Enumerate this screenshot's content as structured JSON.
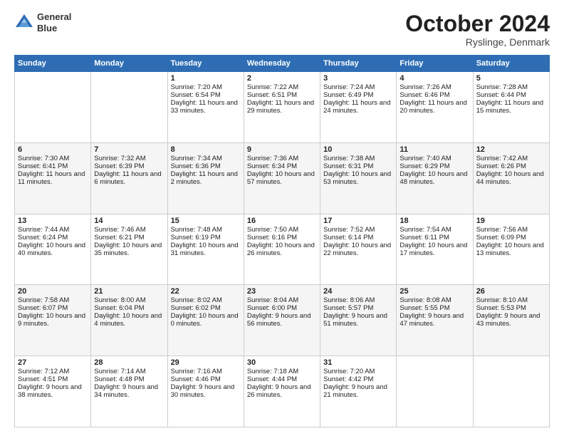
{
  "header": {
    "logo_line1": "General",
    "logo_line2": "Blue",
    "month_title": "October 2024",
    "location": "Ryslinge, Denmark"
  },
  "days_of_week": [
    "Sunday",
    "Monday",
    "Tuesday",
    "Wednesday",
    "Thursday",
    "Friday",
    "Saturday"
  ],
  "weeks": [
    [
      {
        "day": "",
        "sunrise": "",
        "sunset": "",
        "daylight": ""
      },
      {
        "day": "",
        "sunrise": "",
        "sunset": "",
        "daylight": ""
      },
      {
        "day": "1",
        "sunrise": "Sunrise: 7:20 AM",
        "sunset": "Sunset: 6:54 PM",
        "daylight": "Daylight: 11 hours and 33 minutes."
      },
      {
        "day": "2",
        "sunrise": "Sunrise: 7:22 AM",
        "sunset": "Sunset: 6:51 PM",
        "daylight": "Daylight: 11 hours and 29 minutes."
      },
      {
        "day": "3",
        "sunrise": "Sunrise: 7:24 AM",
        "sunset": "Sunset: 6:49 PM",
        "daylight": "Daylight: 11 hours and 24 minutes."
      },
      {
        "day": "4",
        "sunrise": "Sunrise: 7:26 AM",
        "sunset": "Sunset: 6:46 PM",
        "daylight": "Daylight: 11 hours and 20 minutes."
      },
      {
        "day": "5",
        "sunrise": "Sunrise: 7:28 AM",
        "sunset": "Sunset: 6:44 PM",
        "daylight": "Daylight: 11 hours and 15 minutes."
      }
    ],
    [
      {
        "day": "6",
        "sunrise": "Sunrise: 7:30 AM",
        "sunset": "Sunset: 6:41 PM",
        "daylight": "Daylight: 11 hours and 11 minutes."
      },
      {
        "day": "7",
        "sunrise": "Sunrise: 7:32 AM",
        "sunset": "Sunset: 6:39 PM",
        "daylight": "Daylight: 11 hours and 6 minutes."
      },
      {
        "day": "8",
        "sunrise": "Sunrise: 7:34 AM",
        "sunset": "Sunset: 6:36 PM",
        "daylight": "Daylight: 11 hours and 2 minutes."
      },
      {
        "day": "9",
        "sunrise": "Sunrise: 7:36 AM",
        "sunset": "Sunset: 6:34 PM",
        "daylight": "Daylight: 10 hours and 57 minutes."
      },
      {
        "day": "10",
        "sunrise": "Sunrise: 7:38 AM",
        "sunset": "Sunset: 6:31 PM",
        "daylight": "Daylight: 10 hours and 53 minutes."
      },
      {
        "day": "11",
        "sunrise": "Sunrise: 7:40 AM",
        "sunset": "Sunset: 6:29 PM",
        "daylight": "Daylight: 10 hours and 48 minutes."
      },
      {
        "day": "12",
        "sunrise": "Sunrise: 7:42 AM",
        "sunset": "Sunset: 6:26 PM",
        "daylight": "Daylight: 10 hours and 44 minutes."
      }
    ],
    [
      {
        "day": "13",
        "sunrise": "Sunrise: 7:44 AM",
        "sunset": "Sunset: 6:24 PM",
        "daylight": "Daylight: 10 hours and 40 minutes."
      },
      {
        "day": "14",
        "sunrise": "Sunrise: 7:46 AM",
        "sunset": "Sunset: 6:21 PM",
        "daylight": "Daylight: 10 hours and 35 minutes."
      },
      {
        "day": "15",
        "sunrise": "Sunrise: 7:48 AM",
        "sunset": "Sunset: 6:19 PM",
        "daylight": "Daylight: 10 hours and 31 minutes."
      },
      {
        "day": "16",
        "sunrise": "Sunrise: 7:50 AM",
        "sunset": "Sunset: 6:16 PM",
        "daylight": "Daylight: 10 hours and 26 minutes."
      },
      {
        "day": "17",
        "sunrise": "Sunrise: 7:52 AM",
        "sunset": "Sunset: 6:14 PM",
        "daylight": "Daylight: 10 hours and 22 minutes."
      },
      {
        "day": "18",
        "sunrise": "Sunrise: 7:54 AM",
        "sunset": "Sunset: 6:11 PM",
        "daylight": "Daylight: 10 hours and 17 minutes."
      },
      {
        "day": "19",
        "sunrise": "Sunrise: 7:56 AM",
        "sunset": "Sunset: 6:09 PM",
        "daylight": "Daylight: 10 hours and 13 minutes."
      }
    ],
    [
      {
        "day": "20",
        "sunrise": "Sunrise: 7:58 AM",
        "sunset": "Sunset: 6:07 PM",
        "daylight": "Daylight: 10 hours and 9 minutes."
      },
      {
        "day": "21",
        "sunrise": "Sunrise: 8:00 AM",
        "sunset": "Sunset: 6:04 PM",
        "daylight": "Daylight: 10 hours and 4 minutes."
      },
      {
        "day": "22",
        "sunrise": "Sunrise: 8:02 AM",
        "sunset": "Sunset: 6:02 PM",
        "daylight": "Daylight: 10 hours and 0 minutes."
      },
      {
        "day": "23",
        "sunrise": "Sunrise: 8:04 AM",
        "sunset": "Sunset: 6:00 PM",
        "daylight": "Daylight: 9 hours and 56 minutes."
      },
      {
        "day": "24",
        "sunrise": "Sunrise: 8:06 AM",
        "sunset": "Sunset: 5:57 PM",
        "daylight": "Daylight: 9 hours and 51 minutes."
      },
      {
        "day": "25",
        "sunrise": "Sunrise: 8:08 AM",
        "sunset": "Sunset: 5:55 PM",
        "daylight": "Daylight: 9 hours and 47 minutes."
      },
      {
        "day": "26",
        "sunrise": "Sunrise: 8:10 AM",
        "sunset": "Sunset: 5:53 PM",
        "daylight": "Daylight: 9 hours and 43 minutes."
      }
    ],
    [
      {
        "day": "27",
        "sunrise": "Sunrise: 7:12 AM",
        "sunset": "Sunset: 4:51 PM",
        "daylight": "Daylight: 9 hours and 38 minutes."
      },
      {
        "day": "28",
        "sunrise": "Sunrise: 7:14 AM",
        "sunset": "Sunset: 4:48 PM",
        "daylight": "Daylight: 9 hours and 34 minutes."
      },
      {
        "day": "29",
        "sunrise": "Sunrise: 7:16 AM",
        "sunset": "Sunset: 4:46 PM",
        "daylight": "Daylight: 9 hours and 30 minutes."
      },
      {
        "day": "30",
        "sunrise": "Sunrise: 7:18 AM",
        "sunset": "Sunset: 4:44 PM",
        "daylight": "Daylight: 9 hours and 26 minutes."
      },
      {
        "day": "31",
        "sunrise": "Sunrise: 7:20 AM",
        "sunset": "Sunset: 4:42 PM",
        "daylight": "Daylight: 9 hours and 21 minutes."
      },
      {
        "day": "",
        "sunrise": "",
        "sunset": "",
        "daylight": ""
      },
      {
        "day": "",
        "sunrise": "",
        "sunset": "",
        "daylight": ""
      }
    ]
  ]
}
